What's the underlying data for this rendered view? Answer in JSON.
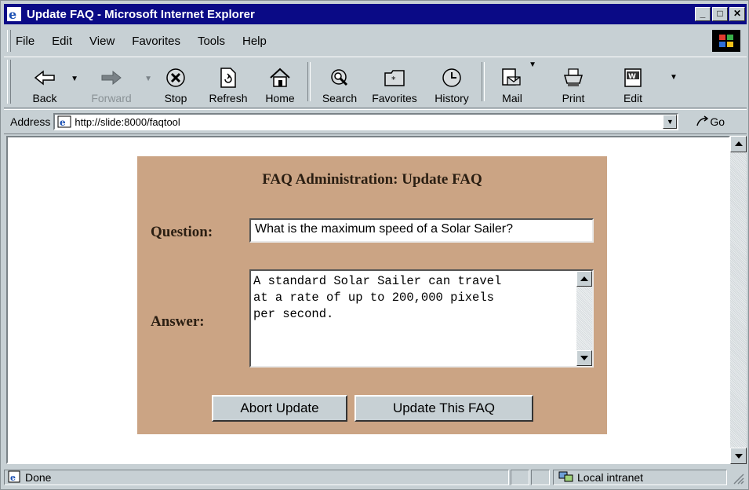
{
  "window": {
    "title": "Update FAQ - Microsoft Internet Explorer"
  },
  "menu": [
    "File",
    "Edit",
    "View",
    "Favorites",
    "Tools",
    "Help"
  ],
  "toolbar": {
    "back": "Back",
    "forward": "Forward",
    "stop": "Stop",
    "refresh": "Refresh",
    "home": "Home",
    "search": "Search",
    "favorites": "Favorites",
    "history": "History",
    "mail": "Mail",
    "print": "Print",
    "edit": "Edit"
  },
  "address": {
    "label": "Address",
    "url": "http://slide:8000/faqtool",
    "go": "Go"
  },
  "page": {
    "heading": "FAQ Administration: Update FAQ",
    "question_label": "Question:",
    "question_value": "What is the maximum speed of a Solar Sailer?",
    "answer_label": "Answer:",
    "answer_value": "A standard Solar Sailer can travel\nat a rate of up to 200,000 pixels\nper second.",
    "abort_button": "Abort Update",
    "update_button": "Update This FAQ"
  },
  "status": {
    "text": "Done",
    "zone": "Local intranet"
  },
  "colors": {
    "titlebar": "#0a0a86",
    "chrome": "#c7d0d4",
    "panel": "#cba484"
  }
}
